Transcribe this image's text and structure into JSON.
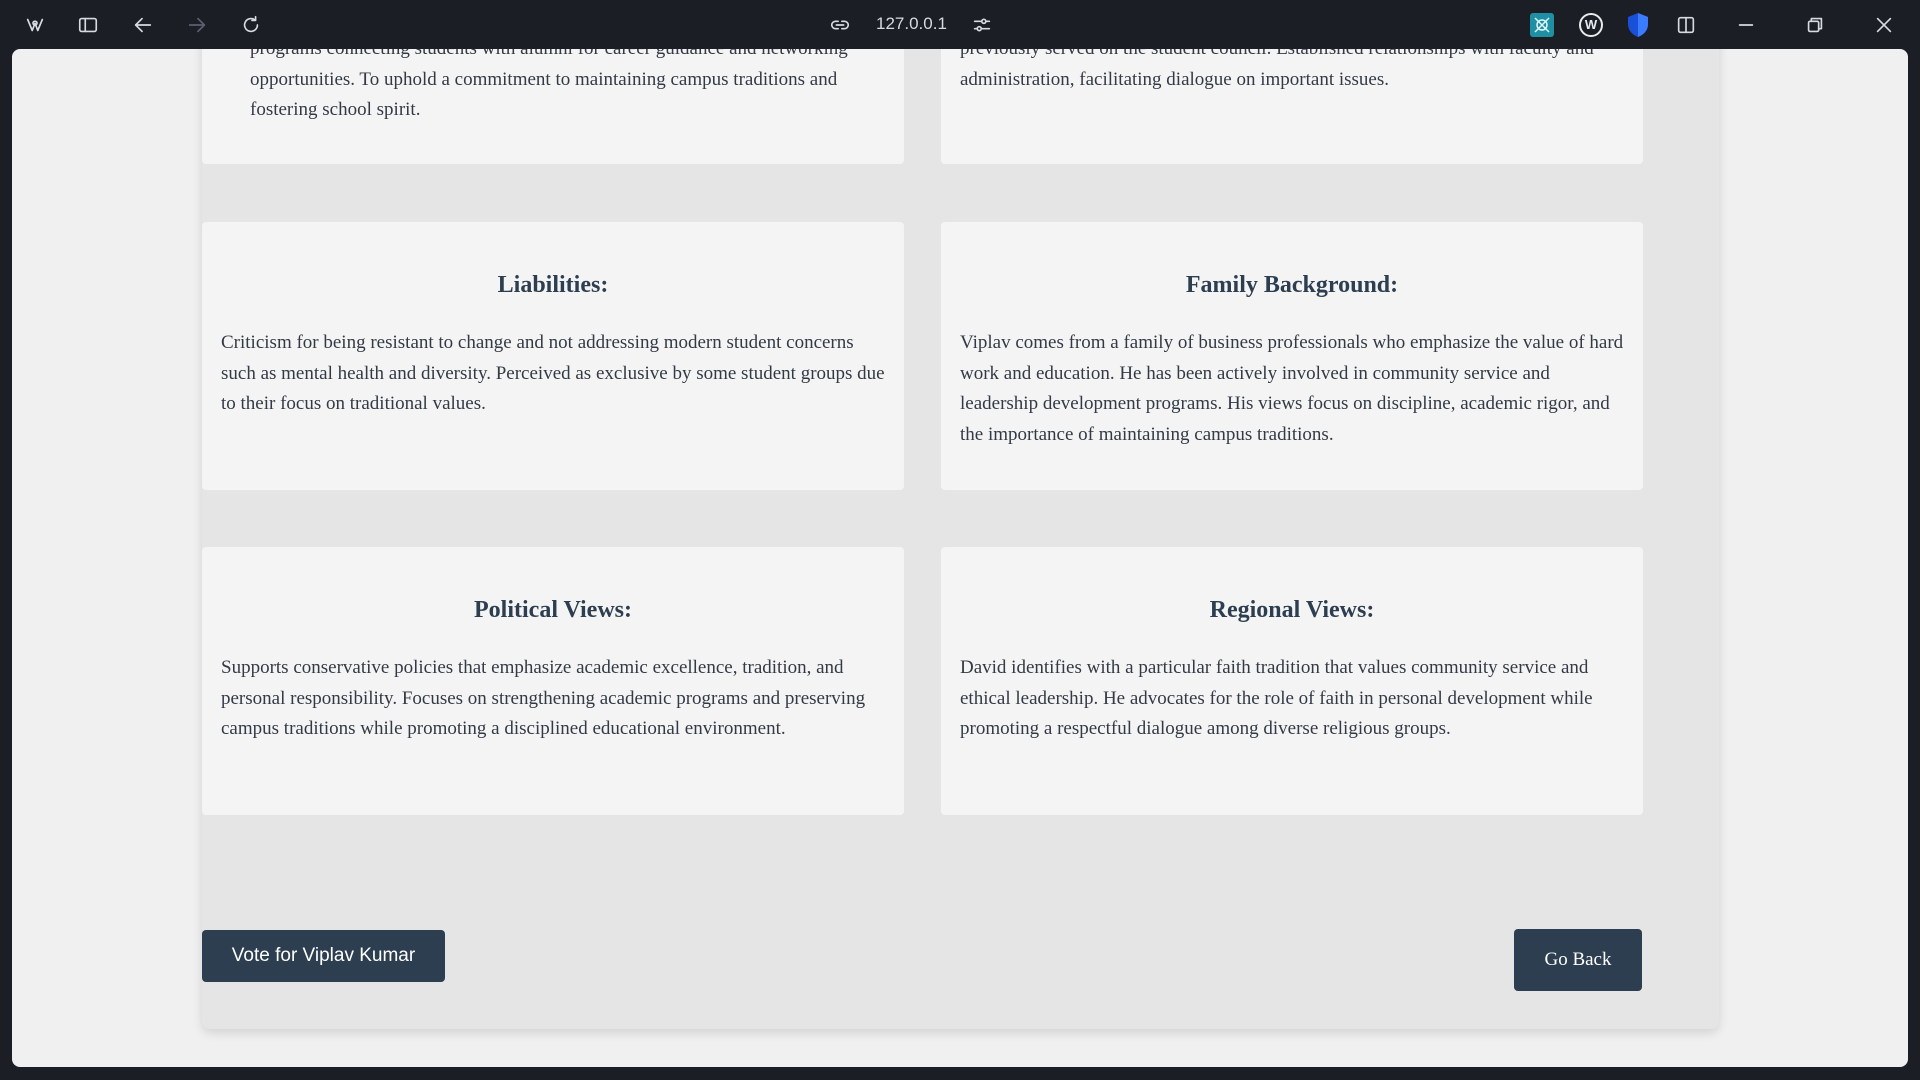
{
  "browser": {
    "address": "127.0.0.1",
    "icons": [
      "browser-logo-icon",
      "sidebar-toggle-icon",
      "back-arrow-icon",
      "forward-arrow-icon",
      "reload-icon",
      "link-icon",
      "site-settings-icon",
      "extension-teal-icon",
      "extension-w-icon",
      "shield-icon",
      "split-view-icon",
      "minimize-icon",
      "restore-icon",
      "close-icon"
    ],
    "ext_w_glyph": "W"
  },
  "cards": {
    "top_left_text": "programs connecting students with alumni for career guidance and networking opportunities. To uphold a commitment to maintaining campus traditions and fostering school spirit.",
    "top_right_text": "previously served on the student council. Established relationships with faculty and administration, facilitating dialogue on important issues.",
    "liabilities": {
      "title": "Liabilities:",
      "text": "Criticism for being resistant to change and not addressing modern student concerns such as mental health and diversity. Perceived as exclusive by some student groups due to their focus on traditional values."
    },
    "family": {
      "title": "Family Background:",
      "text": "Viplav comes from a family of business professionals who emphasize the value of hard work and education. He has been actively involved in community service and leadership development programs. His views focus on discipline, academic rigor, and the importance of maintaining campus traditions."
    },
    "political": {
      "title": "Political Views:",
      "text": "Supports conservative policies that emphasize academic excellence, tradition, and personal responsibility. Focuses on strengthening academic programs and preserving campus traditions while promoting a disciplined educational environment."
    },
    "regional": {
      "title": "Regional Views:",
      "text": "David identifies with a particular faith tradition that values community service and ethical leadership. He advocates for the role of faith in personal development while promoting a respectful dialogue among diverse religious groups."
    }
  },
  "actions": {
    "vote_label": "Vote for Viplav Kumar",
    "back_label": "Go Back"
  },
  "colors": {
    "primary": "#2c3e50",
    "card_bg": "#f4f4f4",
    "panel_bg": "#e5e5e5",
    "chrome_bg": "#1b1e25"
  }
}
